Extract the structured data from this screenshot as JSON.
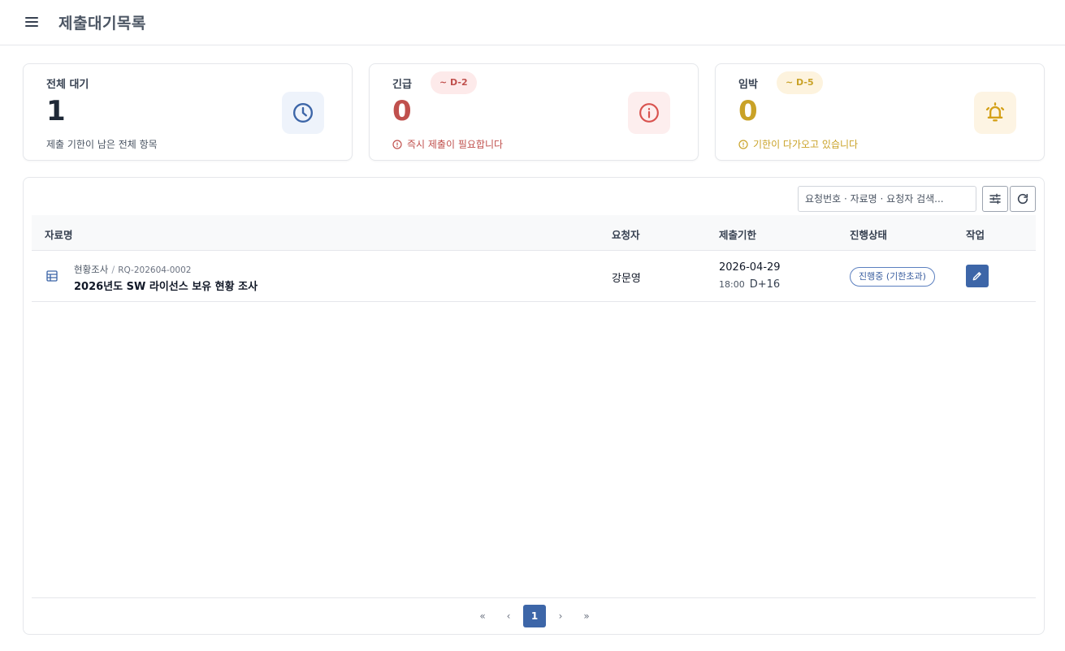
{
  "header": {
    "title": "제출대기목록"
  },
  "stats": {
    "total": {
      "label": "전체 대기",
      "value": "1",
      "desc": "제출 기한이 남은 전체 항목",
      "color": "#1f2937",
      "icon_bg": "#eef3fb",
      "icon_color": "#3d66a8"
    },
    "urgent": {
      "label": "긴급",
      "badge": "~ D-2",
      "value": "0",
      "desc": "즉시 제출이 필요합니다",
      "color": "#c0504d",
      "icon_bg": "#fdeeee",
      "icon_color": "#d9534f"
    },
    "imminent": {
      "label": "임박",
      "badge": "~ D-5",
      "value": "0",
      "desc": "기한이 다가오고 있습니다",
      "color": "#c9a227",
      "icon_bg": "#fdf4e3",
      "icon_color": "#d4a017"
    }
  },
  "search": {
    "placeholder": "요청번호 · 자료명 · 요청자 검색..."
  },
  "table": {
    "headers": {
      "name": "자료명",
      "requester": "요청자",
      "due": "제출기한",
      "status": "진행상태",
      "action": "작업"
    },
    "rows": [
      {
        "category": "현황조사",
        "code": "RQ-202604-0002",
        "title": "2026년도 SW 라이선스 보유 현황 조사",
        "requester": "강문영",
        "due_date": "2026-04-29",
        "due_time": "18:00",
        "d_day": "D+16",
        "status": "진행중 (기한초과)"
      }
    ]
  },
  "pagination": {
    "first": "«",
    "prev": "‹",
    "current": "1",
    "next": "›",
    "last": "»"
  }
}
